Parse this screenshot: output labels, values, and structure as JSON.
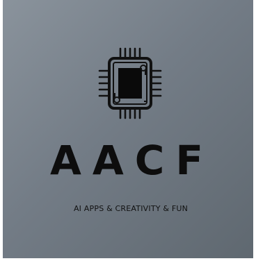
{
  "brand": {
    "name": "AACF",
    "tagline": "AI APPS & CREATIVITY & FUN",
    "logo_icon": "cpu-chip-icon"
  },
  "colors": {
    "background_light": "#8a939c",
    "background_dark": "#5f6870",
    "text": "#0d0d0d"
  }
}
